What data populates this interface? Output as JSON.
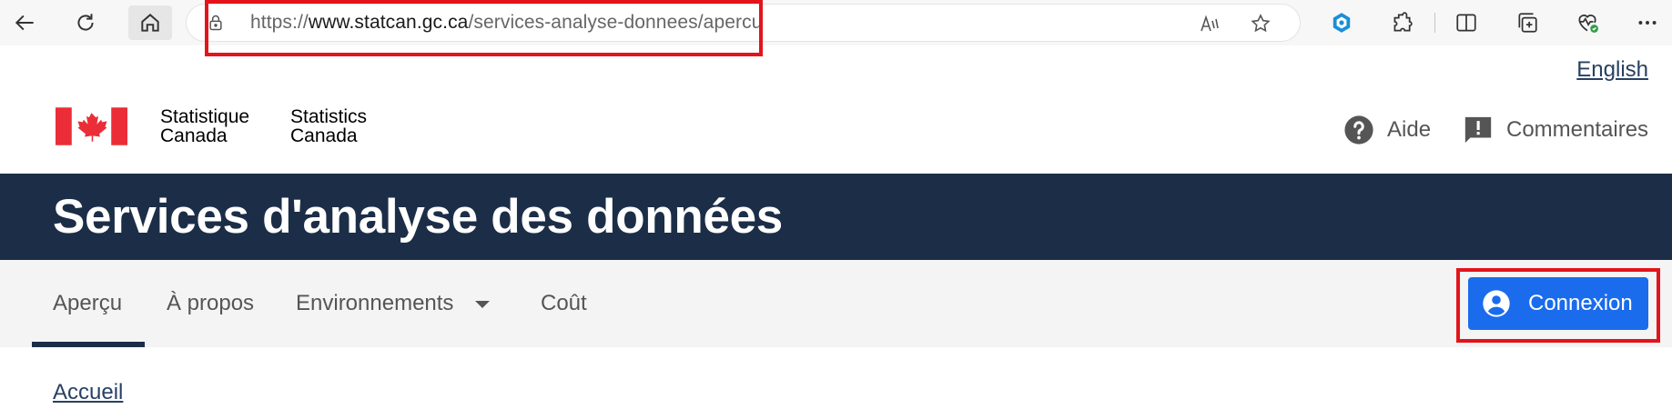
{
  "browser": {
    "url_prefix": "https://",
    "url_domain": "www.statcan.gc.ca",
    "url_path": "/services-analyse-donnees/apercu",
    "icons": [
      "back-icon",
      "refresh-icon",
      "home-icon",
      "lock-icon",
      "read-aloud-icon",
      "favorite-star-icon",
      "copilot-hex-icon",
      "extensions-icon",
      "split-screen-icon",
      "collections-icon",
      "browser-essentials-icon",
      "more-icon"
    ]
  },
  "header": {
    "language_link": "English",
    "logo_fr_line1": "Statistique",
    "logo_fr_line2": "Canada",
    "logo_en_line1": "Statistics",
    "logo_en_line2": "Canada",
    "help_label": "Aide",
    "feedback_label": "Commentaires"
  },
  "banner": {
    "title": "Services d'analyse des données"
  },
  "nav": {
    "tabs": [
      {
        "label": "Aperçu",
        "active": true
      },
      {
        "label": "À propos"
      },
      {
        "label": "Environnements",
        "dropdown": true
      },
      {
        "label": "Coût"
      }
    ],
    "login_label": "Connexion"
  },
  "breadcrumb": {
    "home_label": "Accueil"
  },
  "colors": {
    "banner_bg": "#1c2e47",
    "login_bg": "#1a6ced",
    "highlight": "#e3141b",
    "link": "#284162"
  }
}
